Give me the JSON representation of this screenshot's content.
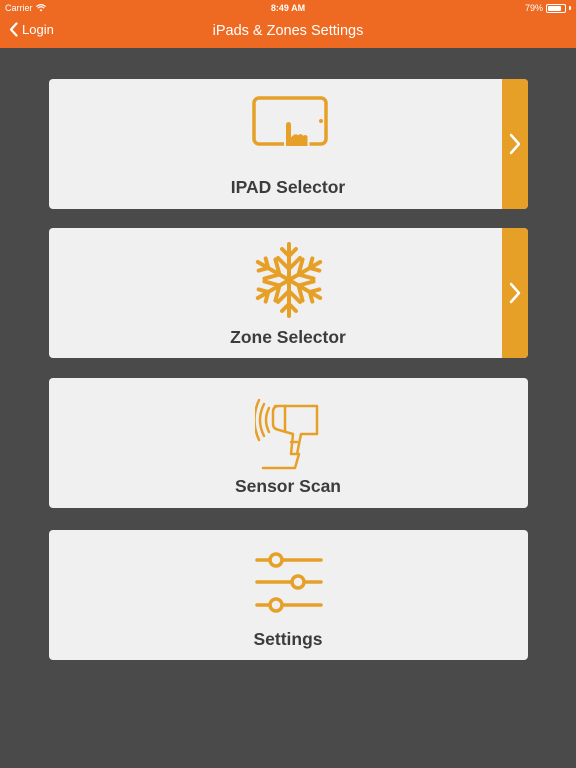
{
  "status_bar": {
    "carrier": "Carrier",
    "time": "8:49 AM",
    "battery": "79%",
    "battery_level": 0.79
  },
  "nav": {
    "back_label": "Login",
    "title": "iPads & Zones Settings"
  },
  "colors": {
    "header": "#ee6a23",
    "background": "#4a4a4a",
    "card": "#f1f0f1",
    "accent": "#e6a028"
  },
  "menu": [
    {
      "label": "IPAD Selector",
      "icon": "tablet-touch-icon",
      "has_arrow": true
    },
    {
      "label": "Zone Selector",
      "icon": "snowflake-icon",
      "has_arrow": true
    },
    {
      "label": "Sensor Scan",
      "icon": "scanner-icon",
      "has_arrow": false
    },
    {
      "label": "Settings",
      "icon": "sliders-icon",
      "has_arrow": false
    }
  ]
}
